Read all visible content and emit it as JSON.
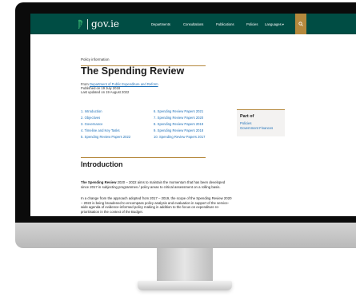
{
  "site": {
    "logo_text": "gov.ie",
    "nav": [
      "Departments",
      "Consultations",
      "Publications",
      "Policies",
      "Languages"
    ],
    "languages_caret": "▾",
    "header_color": "#004d44",
    "accent_color": "#b5893d",
    "link_color": "#1d70b8"
  },
  "page": {
    "kicker": "Policy information",
    "title": "The Spending Review",
    "from_label": "From",
    "from_link": "Department of Public Expenditure and Reform",
    "published": "Published on 19 July 2018",
    "updated": "Last updated on 19 August 2022"
  },
  "toc": {
    "left": [
      "1. Introduction",
      "2. Objectives",
      "3. Governance",
      "4. Timeline and Key Tasks",
      "5. Spending Review Papers 2022"
    ],
    "right": [
      "6. Spending Review Papers 2021",
      "7. Spending Review Papers 2020",
      "8. Spending Review Papers 2019",
      "9. Spending Review Papers 2018",
      "10. Spending Review Papers 2017"
    ]
  },
  "sidebar": {
    "title": "Part of",
    "links": [
      "Policies",
      "Government Finances"
    ]
  },
  "introduction": {
    "heading": "Introduction",
    "p1_bold": "The Spending Review",
    "p1_rest": " 2020 – 2022 aims to maintain the momentum that has been developed since 2017 in subjecting programmes / policy areas to critical assessment on a rolling basis.",
    "p2": "In a change from the approach adopted from 2017 – 2019, the scope of the Spending Review 2020 – 2022 is being broadened to encompass policy analysis and evaluation in support of the service-wide agenda of evidence-informed policy making in addition to the focus on expenditure re-prioritisation in the context of the Budget."
  }
}
